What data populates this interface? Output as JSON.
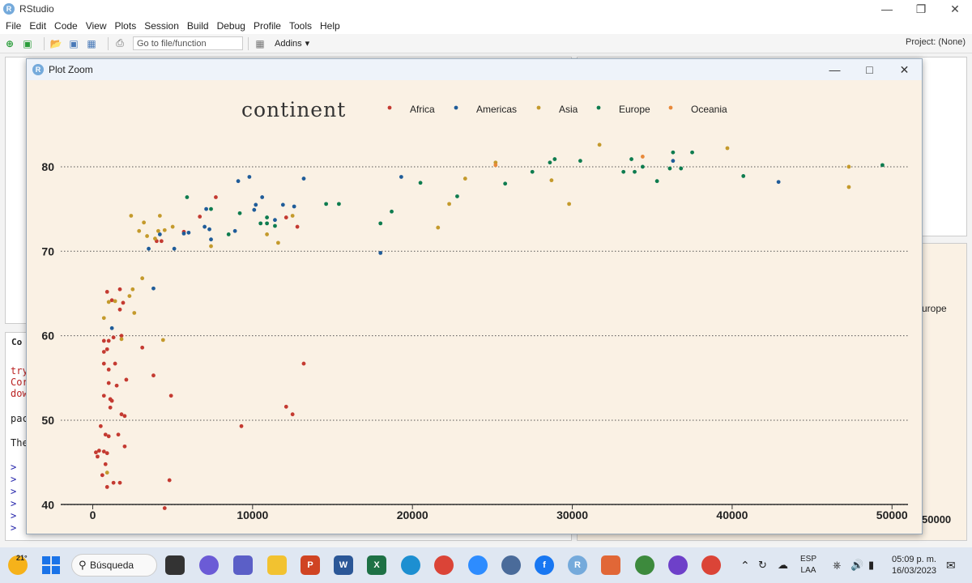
{
  "app": {
    "title": "RStudio",
    "menu": [
      "File",
      "Edit",
      "Code",
      "View",
      "Plots",
      "Session",
      "Build",
      "Debug",
      "Profile",
      "Tools",
      "Help"
    ],
    "goto_placeholder": "Go to file/function",
    "addins_label": "Addins",
    "project_label": "Project: (None)"
  },
  "background": {
    "console_lines": [
      "try",
      "Cor",
      "dow",
      "pac",
      "The"
    ],
    "console_header": "Co",
    "prompt": ">",
    "right_text": "urope",
    "right_tick": "50000"
  },
  "zoom_window": {
    "title": "Plot Zoom"
  },
  "chart_data": {
    "type": "scatter",
    "legend_title": "continent",
    "legend_placement": "top",
    "xlim": [
      -2000,
      51000
    ],
    "ylim": [
      38.5,
      84.5
    ],
    "x_ticks": [
      "0",
      "10000",
      "20000",
      "30000",
      "40000",
      "50000"
    ],
    "x_tick_values": [
      0,
      10000,
      20000,
      30000,
      40000,
      50000
    ],
    "y_ticks": [
      "40",
      "50",
      "60",
      "70",
      "80"
    ],
    "y_tick_values": [
      40,
      50,
      60,
      70,
      80
    ],
    "grid": "horizontal dotted",
    "series": [
      {
        "name": "Africa",
        "color": "#c43a31",
        "points": [
          [
            4500,
            39.6
          ],
          [
            900,
            42.1
          ],
          [
            1300,
            42.6
          ],
          [
            1700,
            42.6
          ],
          [
            600,
            43.5
          ],
          [
            4800,
            42.9
          ],
          [
            800,
            44.8
          ],
          [
            300,
            45.7
          ],
          [
            200,
            46.2
          ],
          [
            700,
            46.3
          ],
          [
            400,
            46.4
          ],
          [
            900,
            46.1
          ],
          [
            2000,
            46.9
          ],
          [
            800,
            48.3
          ],
          [
            1600,
            48.3
          ],
          [
            1000,
            48.1
          ],
          [
            500,
            49.3
          ],
          [
            9300,
            49.3
          ],
          [
            1800,
            50.7
          ],
          [
            2000,
            50.5
          ],
          [
            12500,
            50.7
          ],
          [
            12100,
            51.6
          ],
          [
            1100,
            51.5
          ],
          [
            1200,
            52.3
          ],
          [
            1100,
            52.5
          ],
          [
            700,
            52.9
          ],
          [
            4900,
            52.9
          ],
          [
            1500,
            54.1
          ],
          [
            2100,
            54.8
          ],
          [
            1000,
            54.4
          ],
          [
            3800,
            55.3
          ],
          [
            1000,
            56.0
          ],
          [
            1400,
            56.7
          ],
          [
            700,
            56.7
          ],
          [
            13200,
            56.7
          ],
          [
            700,
            58.1
          ],
          [
            900,
            58.4
          ],
          [
            3100,
            58.6
          ],
          [
            700,
            59.4
          ],
          [
            1000,
            59.4
          ],
          [
            1300,
            59.8
          ],
          [
            1800,
            60.0
          ],
          [
            1700,
            63.1
          ],
          [
            1900,
            63.9
          ],
          [
            1200,
            64.2
          ],
          [
            900,
            65.2
          ],
          [
            1700,
            65.5
          ],
          [
            7700,
            76.4
          ],
          [
            6700,
            74.1
          ],
          [
            12100,
            74.0
          ],
          [
            12800,
            72.9
          ],
          [
            4300,
            71.2
          ],
          [
            5700,
            72.3
          ],
          [
            4000,
            71.2
          ]
        ]
      },
      {
        "name": "Americas",
        "color": "#1f5c99",
        "points": [
          [
            1200,
            60.9
          ],
          [
            3800,
            65.6
          ],
          [
            3500,
            70.3
          ],
          [
            4200,
            72.0
          ],
          [
            5100,
            70.3
          ],
          [
            5700,
            72.1
          ],
          [
            6000,
            72.2
          ],
          [
            7000,
            72.9
          ],
          [
            7100,
            75.0
          ],
          [
            7300,
            72.6
          ],
          [
            7400,
            71.4
          ],
          [
            8900,
            72.4
          ],
          [
            9100,
            78.3
          ],
          [
            9800,
            78.8
          ],
          [
            10100,
            74.9
          ],
          [
            10200,
            75.5
          ],
          [
            10600,
            76.4
          ],
          [
            11400,
            73.7
          ],
          [
            11900,
            75.5
          ],
          [
            12600,
            75.3
          ],
          [
            13200,
            78.6
          ],
          [
            18000,
            69.8
          ],
          [
            19300,
            78.8
          ],
          [
            36300,
            80.7
          ],
          [
            42900,
            78.2
          ]
        ]
      },
      {
        "name": "Asia",
        "color": "#c49a2c",
        "points": [
          [
            900,
            43.8
          ],
          [
            700,
            62.1
          ],
          [
            1000,
            64.0
          ],
          [
            1400,
            64.1
          ],
          [
            2300,
            64.7
          ],
          [
            2500,
            65.5
          ],
          [
            3100,
            66.8
          ],
          [
            2600,
            62.7
          ],
          [
            1800,
            59.6
          ],
          [
            4400,
            59.5
          ],
          [
            2400,
            74.2
          ],
          [
            3200,
            73.4
          ],
          [
            3400,
            71.8
          ],
          [
            3900,
            71.5
          ],
          [
            4200,
            74.2
          ],
          [
            4100,
            72.4
          ],
          [
            4500,
            72.5
          ],
          [
            5000,
            72.9
          ],
          [
            7400,
            70.6
          ],
          [
            10900,
            72.0
          ],
          [
            11600,
            71.0
          ],
          [
            12500,
            74.2
          ],
          [
            21600,
            72.8
          ],
          [
            22300,
            75.6
          ],
          [
            23300,
            78.6
          ],
          [
            25200,
            80.5
          ],
          [
            28700,
            78.4
          ],
          [
            29800,
            75.6
          ],
          [
            31700,
            82.6
          ],
          [
            39700,
            82.2
          ],
          [
            47300,
            80.0
          ],
          [
            47300,
            77.6
          ],
          [
            2900,
            72.4
          ]
        ]
      },
      {
        "name": "Europe",
        "color": "#0e7c4f",
        "points": [
          [
            5900,
            76.4
          ],
          [
            7400,
            75.0
          ],
          [
            8500,
            72.0
          ],
          [
            9200,
            74.5
          ],
          [
            10500,
            73.3
          ],
          [
            11400,
            73.0
          ],
          [
            14600,
            75.6
          ],
          [
            15400,
            75.6
          ],
          [
            18000,
            73.3
          ],
          [
            18700,
            74.7
          ],
          [
            20500,
            78.1
          ],
          [
            22800,
            76.5
          ],
          [
            25800,
            78.0
          ],
          [
            27500,
            79.4
          ],
          [
            28600,
            80.5
          ],
          [
            28900,
            80.9
          ],
          [
            30500,
            80.7
          ],
          [
            33200,
            79.4
          ],
          [
            33700,
            80.9
          ],
          [
            33900,
            79.4
          ],
          [
            34400,
            80.0
          ],
          [
            35300,
            78.3
          ],
          [
            36100,
            79.8
          ],
          [
            36300,
            81.7
          ],
          [
            36800,
            79.8
          ],
          [
            37500,
            81.7
          ],
          [
            40700,
            78.9
          ],
          [
            49400,
            80.2
          ],
          [
            10900,
            73.3
          ],
          [
            10900,
            74.0
          ]
        ]
      },
      {
        "name": "Oceania",
        "color": "#e8893a",
        "points": [
          [
            25200,
            80.2
          ],
          [
            34400,
            81.2
          ]
        ]
      }
    ]
  },
  "taskbar": {
    "temp": "21°",
    "search_label": "Búsqueda",
    "lang_top": "ESP",
    "lang_bottom": "LAA",
    "time": "05:09 p. m.",
    "date": "16/03/2023"
  }
}
